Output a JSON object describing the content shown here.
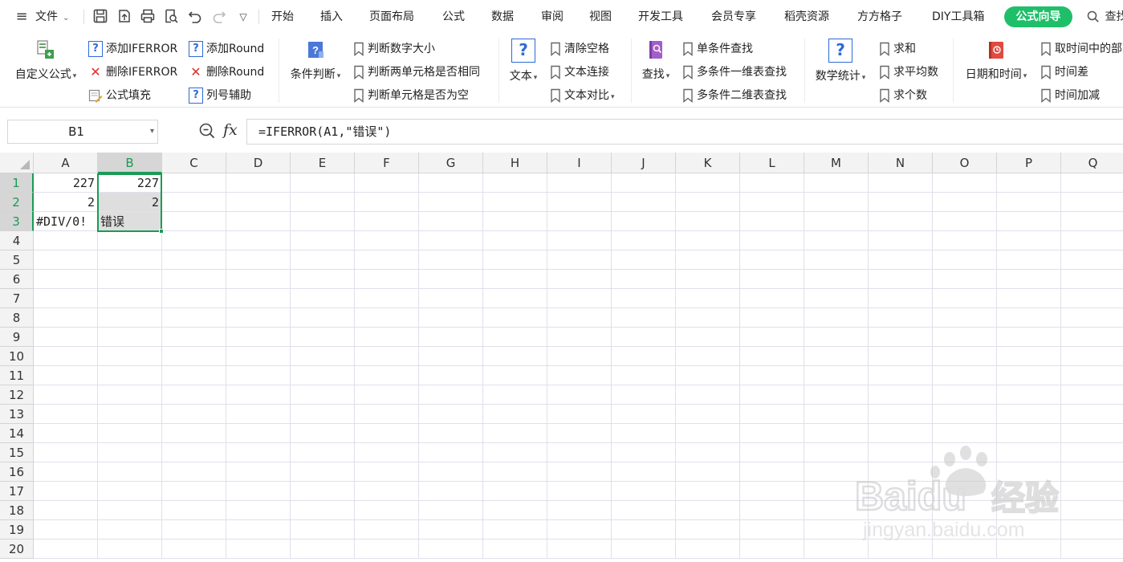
{
  "menubar": {
    "file_label": "文件",
    "tabs": [
      "开始",
      "插入",
      "页面布局",
      "公式",
      "数据",
      "审阅",
      "视图",
      "开发工具",
      "会员专享",
      "稻壳资源",
      "方方格子",
      "DIY工具箱"
    ],
    "active_tab": "公式向导",
    "search_label": "查找"
  },
  "ribbon": {
    "custom_formula": "自定义公式",
    "add_iferror": "添加IFERROR",
    "del_iferror": "删除IFERROR",
    "formula_fill": "公式填充",
    "add_round": "添加Round",
    "del_round": "删除Round",
    "col_helper": "列号辅助",
    "cond_judge": "条件判断",
    "judge_num_size": "判断数字大小",
    "judge_two_same": "判断两单元格是否相同",
    "judge_cell_empty": "判断单元格是否为空",
    "text": "文本",
    "clear_spaces": "清除空格",
    "text_concat": "文本连接",
    "text_compare": "文本对比",
    "lookup": "查找",
    "single_lookup": "单条件查找",
    "multi_1d_lookup": "多条件一维表查找",
    "multi_2d_lookup": "多条件二维表查找",
    "math_stats": "数学统计",
    "sum": "求和",
    "average": "求平均数",
    "count": "求个数",
    "datetime": "日期和时间",
    "take_time_part": "取时间中的部",
    "time_diff": "时间差",
    "time_add": "时间加减"
  },
  "formula_bar": {
    "name_box": "B1",
    "fx": "fx",
    "formula": "=IFERROR(A1,\"错误\")"
  },
  "grid": {
    "columns": [
      "A",
      "B",
      "C",
      "D",
      "E",
      "F",
      "G",
      "H",
      "I",
      "J",
      "K",
      "L",
      "M",
      "N",
      "O",
      "P",
      "Q"
    ],
    "rows": [
      "1",
      "2",
      "3",
      "4",
      "5",
      "6",
      "7",
      "8",
      "9",
      "10",
      "11",
      "12",
      "13",
      "14",
      "15",
      "16",
      "17",
      "18",
      "19",
      "20"
    ],
    "selected_column": "B",
    "selected_rows": [
      "1",
      "2",
      "3"
    ],
    "cells": {
      "A1": "227",
      "B1": "227",
      "A2": "2",
      "B2": "2",
      "A3": "#DIV/0!",
      "B3": "错误"
    }
  },
  "watermark": {
    "brand": "Baidu",
    "brand_cn": "经验",
    "url": "jingyan.baidu.com"
  },
  "colors": {
    "accent_green": "#1b9a55",
    "tab_green": "#1fbf6a",
    "error_red": "#d9342b",
    "help_blue": "#2d6ad6"
  }
}
